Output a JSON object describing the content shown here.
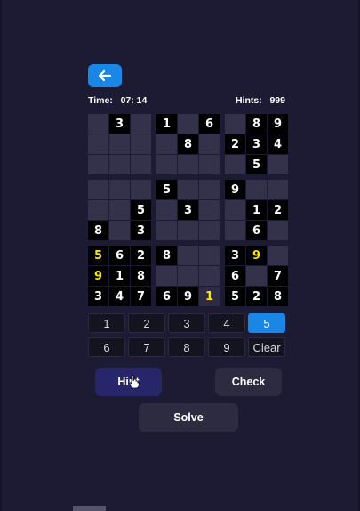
{
  "timer": {
    "label": "Time:",
    "value": "07: 14"
  },
  "hints": {
    "label": "Hints:",
    "value": "999"
  },
  "board": {
    "rows": [
      [
        "",
        "3",
        "",
        "1",
        "",
        "6",
        "",
        "8",
        "9"
      ],
      [
        "",
        "",
        "",
        "",
        "8",
        "",
        "2",
        "3",
        "4"
      ],
      [
        "",
        "",
        "",
        "",
        "",
        "",
        "",
        "5",
        ""
      ],
      [
        "",
        "",
        "",
        "5",
        "",
        "",
        "9",
        "",
        ""
      ],
      [
        "",
        "",
        "5",
        "",
        "3",
        "",
        "",
        "1",
        "2"
      ],
      [
        "8",
        "",
        "3",
        "",
        "",
        "",
        "",
        "6",
        ""
      ],
      [
        "5",
        "6",
        "2",
        "8",
        "",
        "",
        "3",
        "9",
        ""
      ],
      [
        "9",
        "1",
        "8",
        "",
        "",
        "",
        "6",
        "",
        "7"
      ],
      [
        "3",
        "4",
        "7",
        "6",
        "9",
        "1",
        "5",
        "2",
        "8"
      ]
    ],
    "hint_cells": [
      [
        6,
        0
      ],
      [
        7,
        0
      ],
      [
        6,
        7
      ],
      [
        8,
        5
      ]
    ],
    "hint_on_dark": [
      [
        6,
        0
      ],
      [
        7,
        0
      ],
      [
        6,
        7
      ]
    ]
  },
  "number_pad": {
    "row1": [
      "1",
      "2",
      "3",
      "4",
      "5"
    ],
    "row2": [
      "6",
      "7",
      "8",
      "9",
      "Clear"
    ],
    "selected": "5"
  },
  "buttons": {
    "hint": "Hint",
    "check": "Check",
    "solve": "Solve"
  },
  "colors": {
    "background": "#1d1b33",
    "accent": "#1a86e6",
    "hint_digit": "#ffe600",
    "empty_cell": "#34324a",
    "given_cell": "#000000"
  },
  "icons": {
    "back": "arrow-left-icon",
    "pointer": "hand-cursor-icon"
  }
}
